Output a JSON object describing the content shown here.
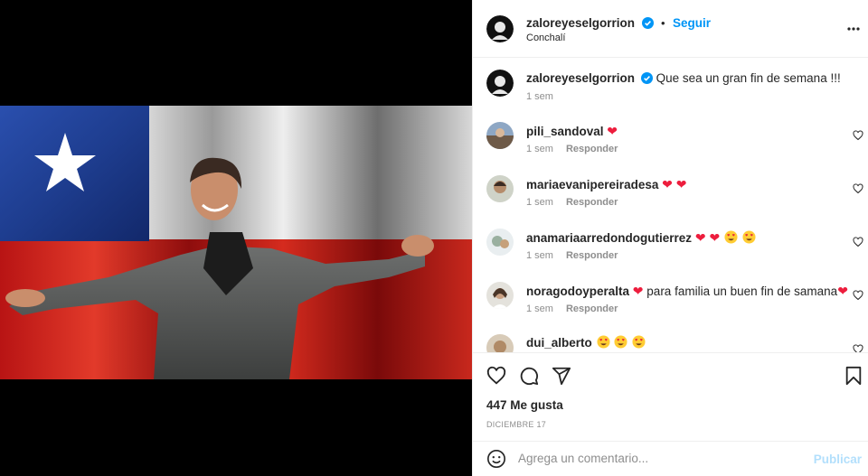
{
  "post": {
    "author": "zaloreyeselgorrion",
    "location": "Conchalí",
    "follow_label": "Seguir",
    "dot": "•",
    "more_icon": "more-horizontal-icon"
  },
  "caption": {
    "author": "zaloreyeselgorrion",
    "text": "Que sea un gran fin de semana !!!",
    "time": "1 sem"
  },
  "comments": [
    {
      "user": "pili_sandoval",
      "text": "",
      "time": "1 sem",
      "reply": "Responder"
    },
    {
      "user": "mariaevanipereiradesa",
      "text": "",
      "time": "1 sem",
      "reply": "Responder"
    },
    {
      "user": "anamariaarredondogutierrez",
      "text": "",
      "time": "1 sem",
      "reply": "Responder"
    },
    {
      "user": "noragodoyperalta",
      "text": "para familia un buen fin de samana",
      "time": "1 sem",
      "reply": "Responder"
    },
    {
      "user": "dui_alberto",
      "text": "",
      "time": "",
      "reply": ""
    }
  ],
  "actions": {
    "likes": "447 Me gusta",
    "date": "DICIEMBRE 17",
    "icons": [
      "heart-icon",
      "comment-icon",
      "share-icon",
      "bookmark-icon"
    ]
  },
  "composer": {
    "placeholder": "Agrega un comentario...",
    "publish_label": "Publicar",
    "emoji_icon": "emoji-icon"
  },
  "colors": {
    "accent": "#0095f6",
    "heart": "#ed1d3d",
    "flag_blue": "#1e3d8f",
    "flag_red": "#d52b1e"
  }
}
